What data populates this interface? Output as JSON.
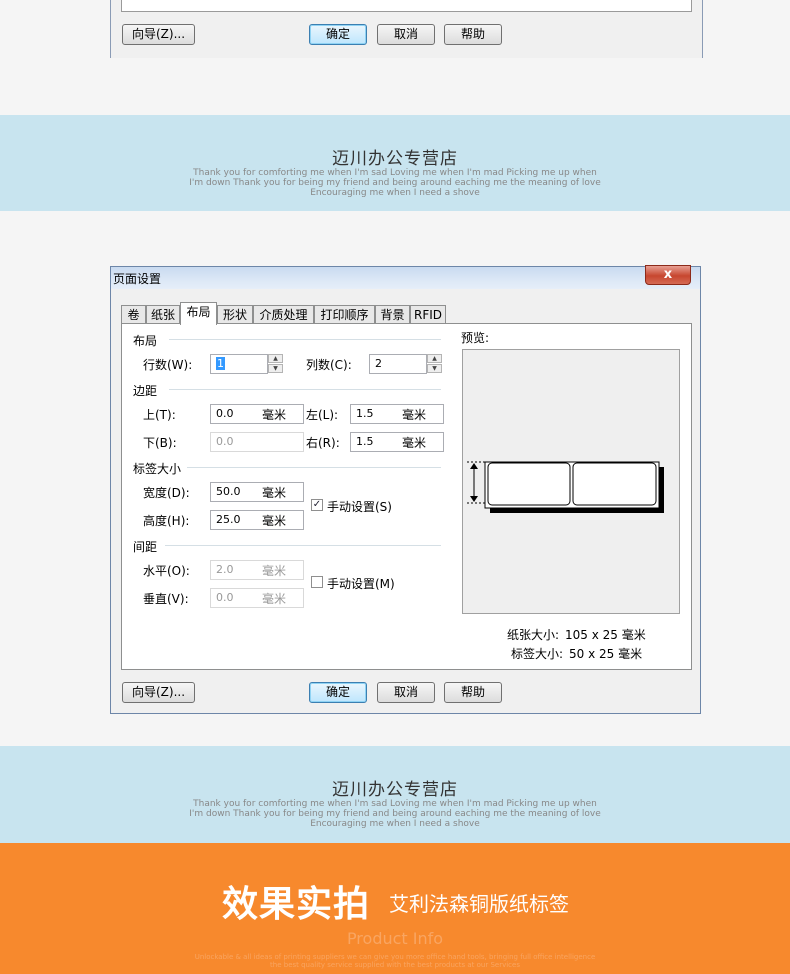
{
  "top_dialog": {
    "wizard_label": "向导(Z)...",
    "ok_label": "确定",
    "cancel_label": "取消",
    "help_label": "帮助"
  },
  "banner": {
    "title": "迈川办公专营店",
    "line1": "Thank you for comforting me when I'm sad Loving me when I'm mad Picking me up when",
    "line2": "I'm down Thank you for being my friend and being around eaching me the meaning of love",
    "line3": "Encouraging me when I need a shove"
  },
  "dialog": {
    "title": "页面设置",
    "close_glyph": "x",
    "tabs": [
      "卷",
      "纸张",
      "布局",
      "形状",
      "介质处理",
      "打印顺序",
      "背景",
      "RFID"
    ],
    "active_tab": "布局",
    "layout": {
      "group_label": "布局",
      "rows_label": "行数(W):",
      "rows_value": "1",
      "cols_label": "列数(C):",
      "cols_value": "2"
    },
    "margins": {
      "group_label": "边距",
      "top_label": "上(T):",
      "top_value": "0.0",
      "bottom_label": "下(B):",
      "bottom_value": "0.0",
      "left_label": "左(L):",
      "left_value": "1.5",
      "right_label": "右(R):",
      "right_value": "1.5",
      "unit": "毫米"
    },
    "label_size": {
      "group_label": "标签大小",
      "width_label": "宽度(D):",
      "width_value": "50.0",
      "height_label": "高度(H):",
      "height_value": "25.0",
      "manual_label": "手动设置(S)",
      "manual_checked": true,
      "unit": "毫米"
    },
    "gap": {
      "group_label": "间距",
      "horizontal_label": "水平(O):",
      "horizontal_value": "2.0",
      "vertical_label": "垂直(V):",
      "vertical_value": "0.0",
      "manual_label": "手动设置(M)",
      "manual_checked": false,
      "unit": "毫米"
    },
    "preview": {
      "label": "预览:",
      "paper_size_label": "纸张大小:",
      "paper_size_value": "105 x 25 毫米",
      "label_size_label": "标签大小:",
      "label_size_value": "50 x 25 毫米"
    },
    "buttons": {
      "wizard_label": "向导(Z)...",
      "ok_label": "确定",
      "cancel_label": "取消",
      "help_label": "帮助"
    }
  },
  "footer": {
    "headline": "效果实拍",
    "subtitle": "艾利法森铜版纸标签",
    "product_info": "Product Info",
    "tiny_line1": "Unlockable & all ideas of printing suppliers we can give you more office hand tools, bringing full office intelligence",
    "tiny_line2": "the best quality service supplied with the best products at our Services"
  }
}
